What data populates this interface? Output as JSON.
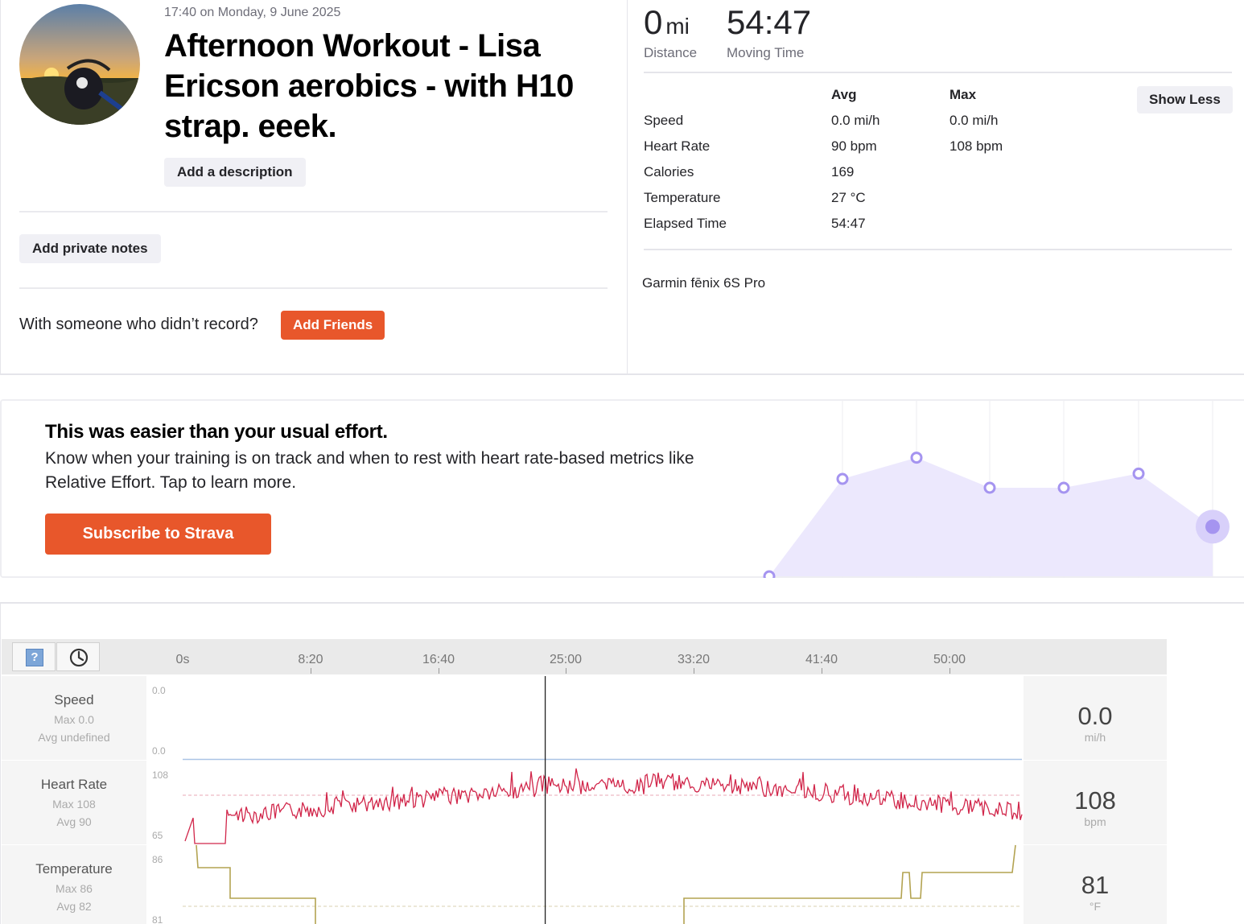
{
  "activity": {
    "datetime": "17:40 on Monday, 9 June 2025",
    "title": "Afternoon Workout - Lisa Ericson aerobics - with H10 strap. eeek.",
    "add_description": "Add a description",
    "add_private_notes": "Add private notes",
    "with_someone": "With someone who didn’t record?",
    "add_friends": "Add Friends"
  },
  "summary": {
    "distance_value": "0",
    "distance_unit": "mi",
    "distance_label": "Distance",
    "moving_time_value": "54:47",
    "moving_time_label": "Moving Time",
    "show_less": "Show Less",
    "headers": {
      "avg": "Avg",
      "max": "Max"
    },
    "rows": [
      {
        "label": "Speed",
        "avg": "0.0 mi/h",
        "max": "0.0 mi/h"
      },
      {
        "label": "Heart Rate",
        "avg": "90 bpm",
        "max": "108 bpm"
      },
      {
        "label": "Calories",
        "avg": "169",
        "max": ""
      },
      {
        "label": "Temperature",
        "avg": "27 °C",
        "max": ""
      },
      {
        "label": "Elapsed Time",
        "avg": "54:47",
        "max": ""
      }
    ],
    "device": "Garmin fēnix 6S Pro"
  },
  "effort": {
    "title": "This was easier than your usual effort.",
    "text": "Know when your training is on track and when to rest with heart rate-based metrics like Relative Effort. Tap to learn more.",
    "subscribe": "Subscribe to Strava",
    "accent": "#e8572b",
    "chart_color": "#a594f0",
    "trend_levels": [
      0,
      0.55,
      0.67,
      0.5,
      0.5,
      0.58,
      0.28
    ]
  },
  "analysis": {
    "time_ticks": [
      "0s",
      "8:20",
      "16:40",
      "25:00",
      "33:20",
      "41:40",
      "50:00"
    ],
    "icons": {
      "help": "help-icon",
      "clock": "clock-icon"
    },
    "help_glyph": "?",
    "cursor_time_fraction": 0.432,
    "rows": [
      {
        "name": "Speed",
        "stat1": "Max 0.0",
        "stat2": "Avg undefined",
        "axis_top": "0.0",
        "axis_bottom": "0.0",
        "value": "0.0",
        "unit": "mi/h"
      },
      {
        "name": "Heart Rate",
        "stat1": "Max 108",
        "stat2": "Avg 90",
        "axis_top": "108",
        "axis_bottom": "65",
        "value": "108",
        "unit": "bpm"
      },
      {
        "name": "Temperature",
        "stat1": "Max 86",
        "stat2": "Avg 82",
        "axis_top": "86",
        "axis_bottom": "81",
        "value": "81",
        "unit": "°F"
      }
    ],
    "colors": {
      "heart_rate": "#d1264a",
      "temperature": "#b3a351",
      "speed": "#aac4e6"
    }
  }
}
